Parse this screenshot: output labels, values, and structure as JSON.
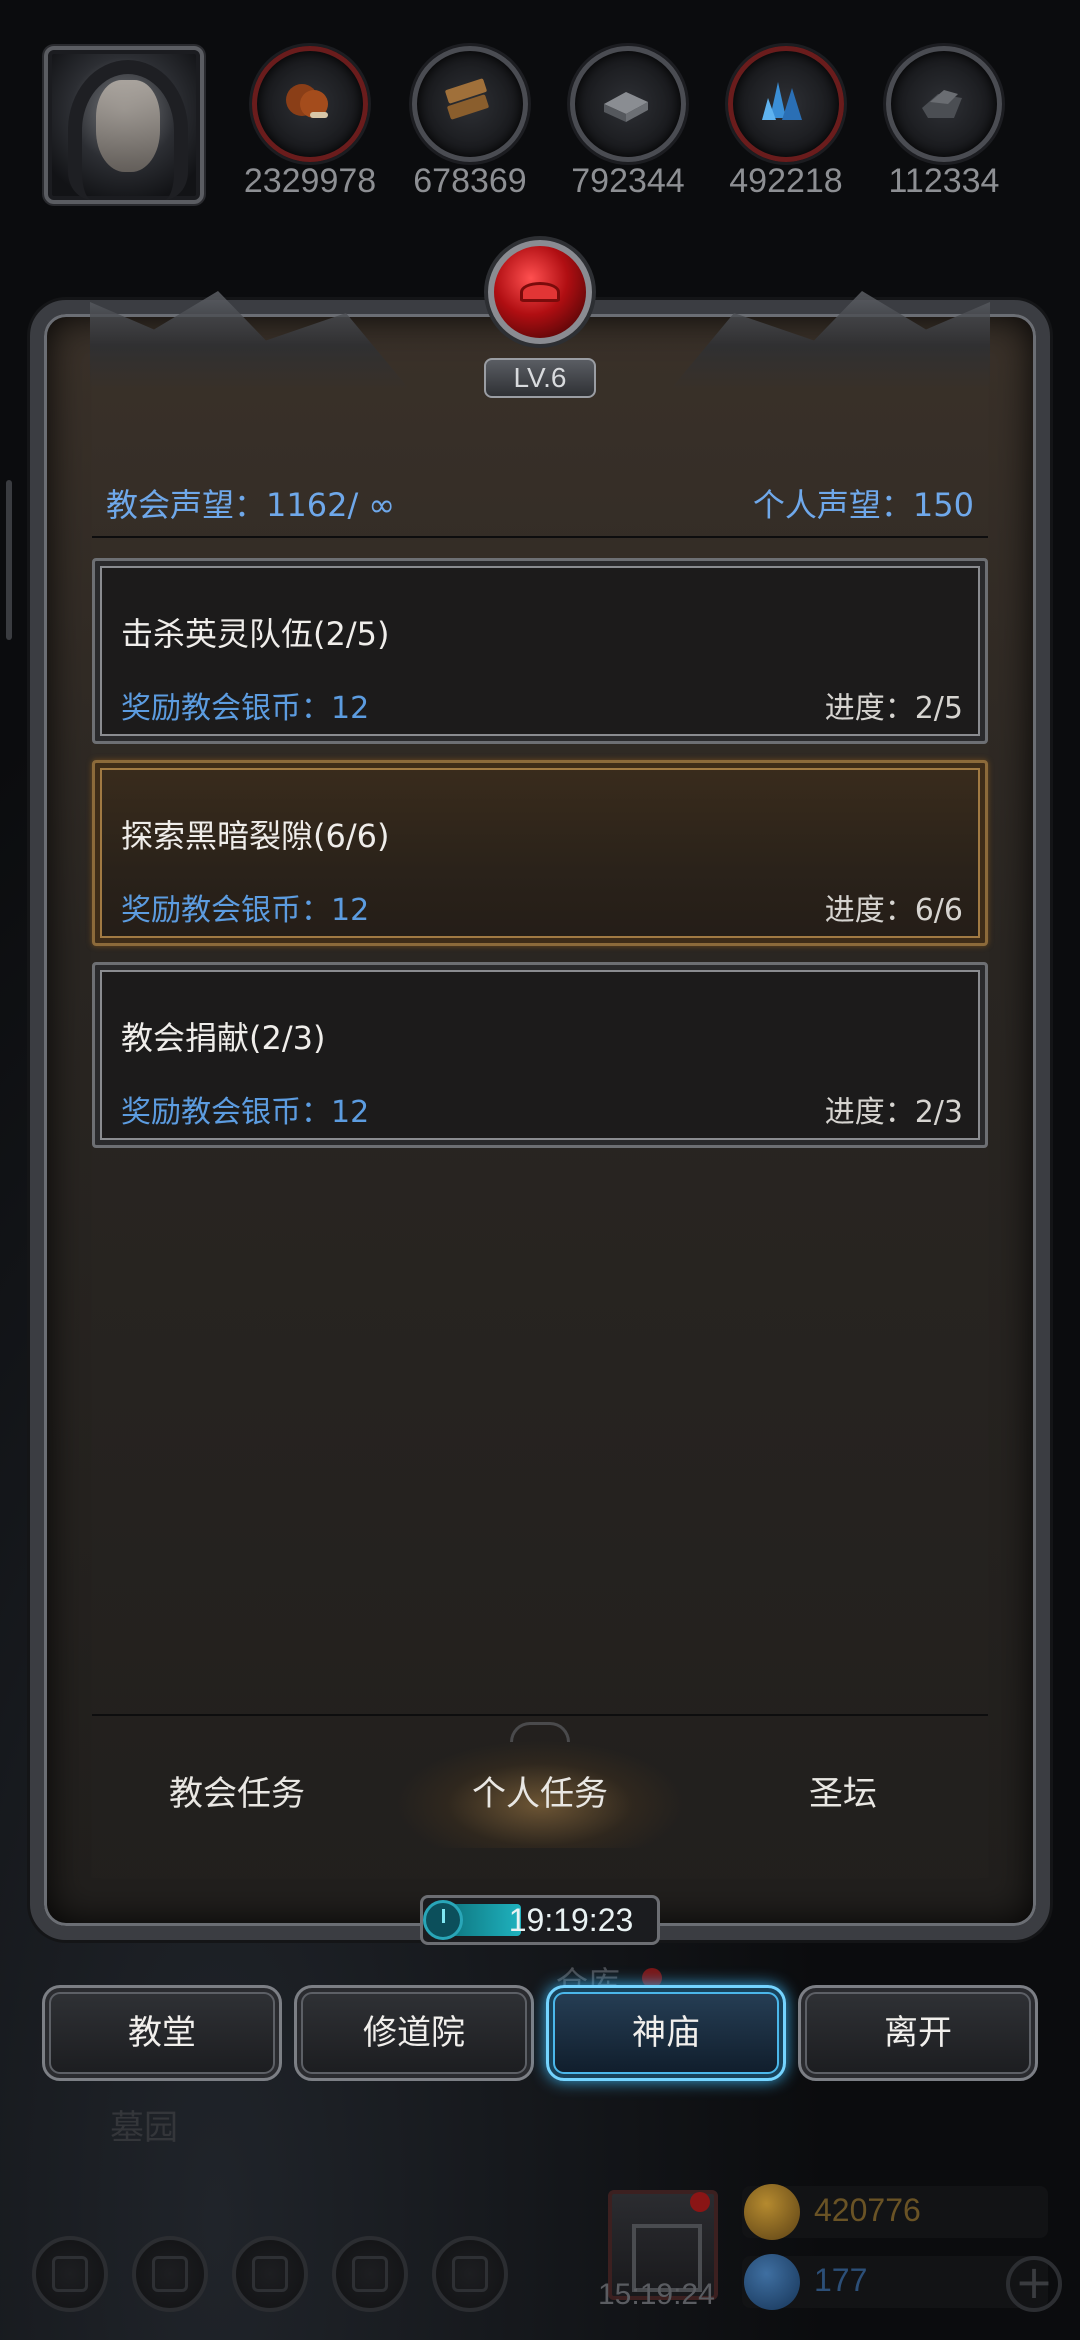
{
  "resources": [
    {
      "icon": "meat-icon",
      "value": "2329978",
      "ring": "red"
    },
    {
      "icon": "wood-icon",
      "value": "678369",
      "ring": "grey"
    },
    {
      "icon": "iron-icon",
      "value": "792344",
      "ring": "grey"
    },
    {
      "icon": "crystal-icon",
      "value": "492218",
      "ring": "red"
    },
    {
      "icon": "stone-icon",
      "value": "112334",
      "ring": "grey"
    }
  ],
  "panel": {
    "level": "LV.6",
    "church_reputation": "教会声望：1162/ ∞",
    "personal_reputation": "个人声望：150",
    "tasks": [
      {
        "title": "击杀英灵队伍(2/5)",
        "reward": "奖励教会银币：12",
        "progress": "进度：2/5",
        "active": false
      },
      {
        "title": "探索黑暗裂隙(6/6)",
        "reward": "奖励教会银币：12",
        "progress": "进度：6/6",
        "active": true
      },
      {
        "title": "教会捐献(2/3)",
        "reward": "奖励教会银币：12",
        "progress": "进度：2/3",
        "active": false
      }
    ],
    "tabs": [
      {
        "label": "教会任务",
        "active": false
      },
      {
        "label": "个人任务",
        "active": true
      },
      {
        "label": "圣坛",
        "active": false
      }
    ],
    "timer": "19:19:23",
    "timer_fill_fraction": 0.4
  },
  "nav": {
    "buttons": [
      {
        "label": "教堂",
        "active": false
      },
      {
        "label": "修道院",
        "active": false
      },
      {
        "label": "神庙",
        "active": true
      },
      {
        "label": "离开",
        "active": false
      }
    ],
    "warehouse_label": "仓库",
    "cemetery_label": "墓园"
  },
  "hud": {
    "gift_timer": "15:19:24",
    "gold": "420776",
    "gems": "177",
    "plus": "+"
  },
  "colors": {
    "reputation_blue": "#6fa8ea",
    "reward_blue": "#5c9ce0",
    "active_nav_glow": "#74d4ff",
    "crest_red": "#b00e12"
  }
}
